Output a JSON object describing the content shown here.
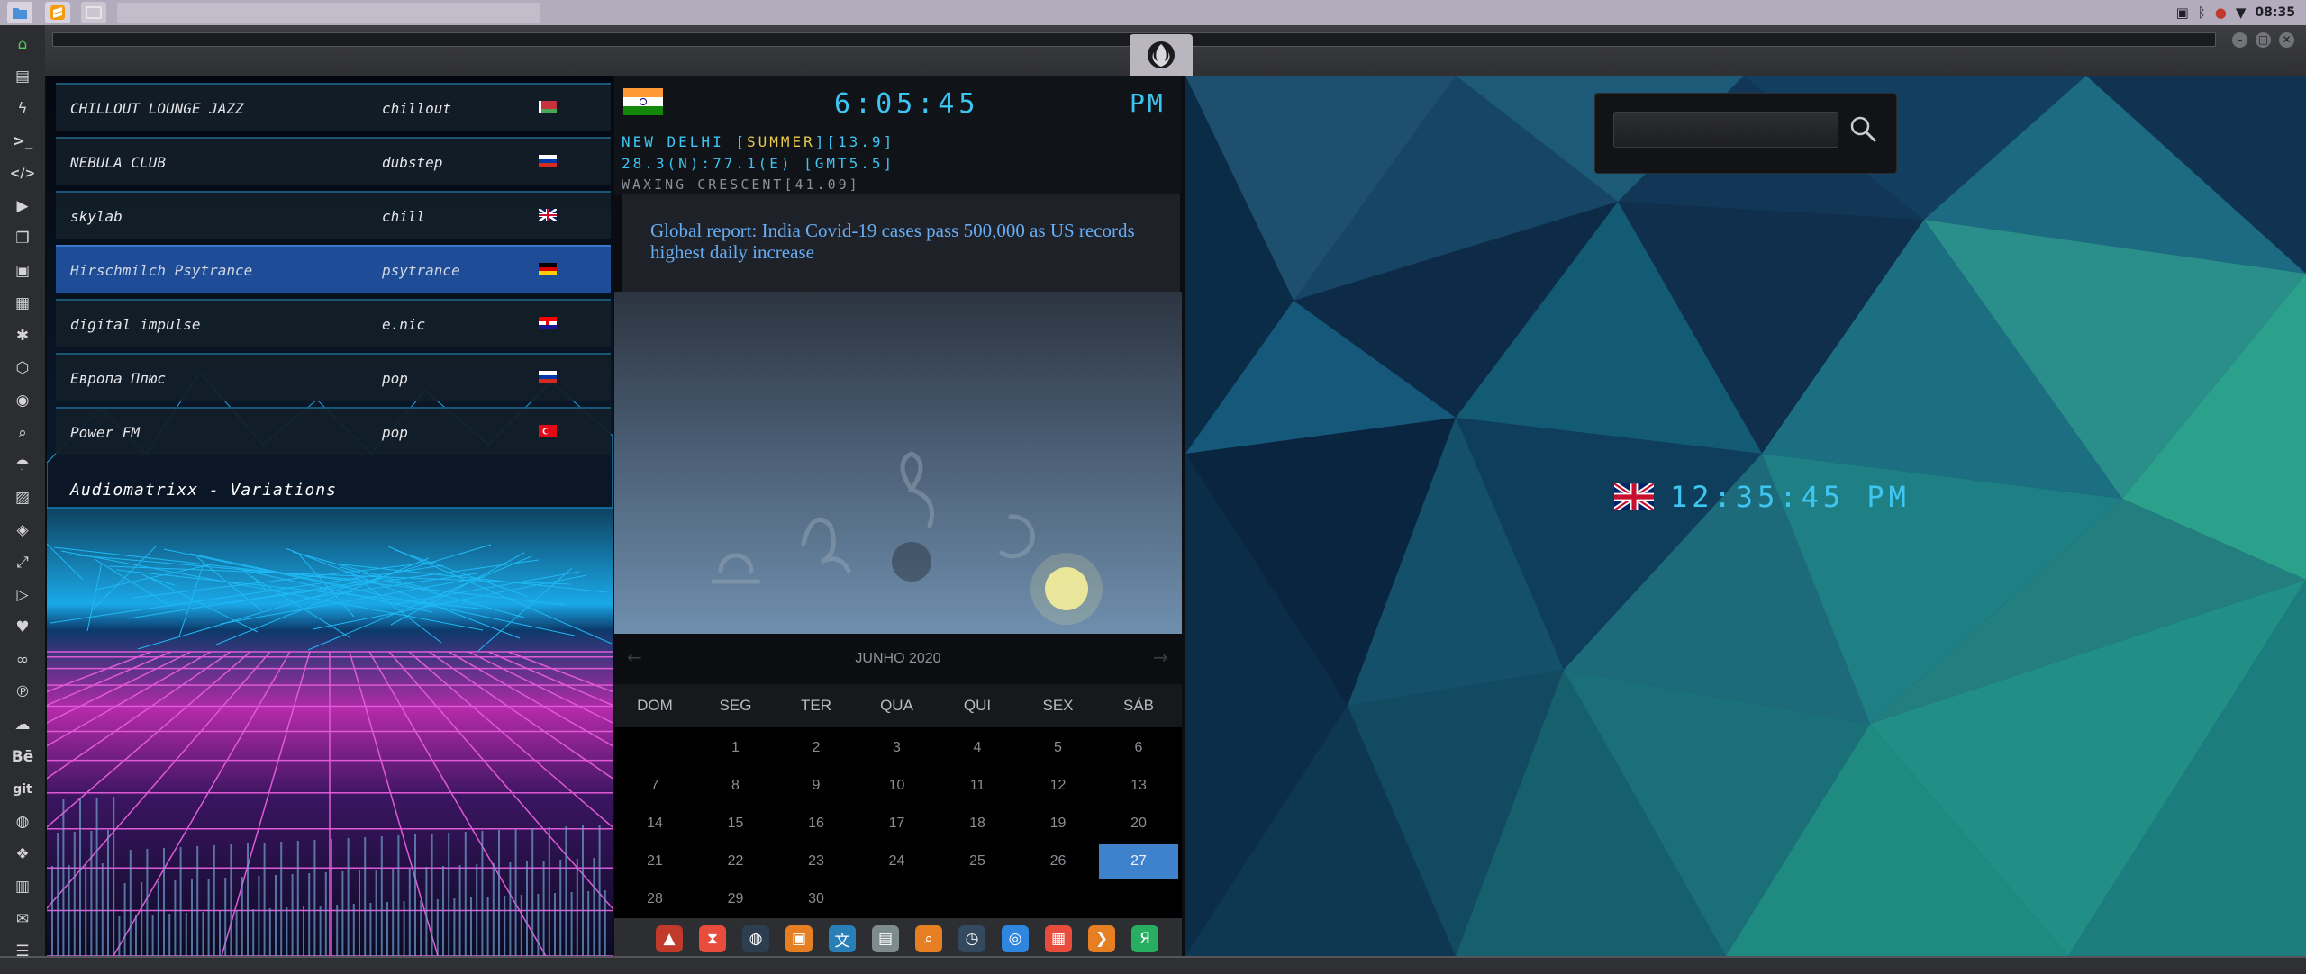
{
  "top_panel": {
    "launchers": [
      {
        "icon": "file-manager-icon"
      },
      {
        "icon": "sublime-text-icon"
      },
      {
        "icon": "app-grid-icon"
      }
    ],
    "tray_icons": [
      "image-icon",
      "bluetooth-icon",
      "alert-icon",
      "wifi-icon"
    ],
    "clock": "08:35"
  },
  "sidebar": {
    "items": [
      {
        "name": "home-icon",
        "glyph": "⌂"
      },
      {
        "name": "document-icon",
        "glyph": "▤"
      },
      {
        "name": "lightning-icon",
        "glyph": "ϟ"
      },
      {
        "name": "terminal-icon",
        "glyph": ">_"
      },
      {
        "name": "code-icon",
        "glyph": "</>"
      },
      {
        "name": "play-icon",
        "glyph": "▶"
      },
      {
        "name": "copy-icon",
        "glyph": "❐"
      },
      {
        "name": "image-icon",
        "glyph": "▣"
      },
      {
        "name": "reader-icon",
        "glyph": "▦"
      },
      {
        "name": "aperture-icon",
        "glyph": "✱"
      },
      {
        "name": "hexagon-icon",
        "glyph": "⬡"
      },
      {
        "name": "globe-icon",
        "glyph": "◉"
      },
      {
        "name": "search-icon",
        "glyph": "⌕"
      },
      {
        "name": "umbrella-icon",
        "glyph": "☂"
      },
      {
        "name": "contact-icon",
        "glyph": "▨"
      },
      {
        "name": "tag-icon",
        "glyph": "◈"
      },
      {
        "name": "expand-icon",
        "glyph": "⤢"
      },
      {
        "name": "youtube-icon",
        "glyph": "▷"
      },
      {
        "name": "heart-icon",
        "glyph": "♥"
      },
      {
        "name": "lastfm-icon",
        "glyph": "∞"
      },
      {
        "name": "pinterest-icon",
        "glyph": "℗"
      },
      {
        "name": "cloud-icon",
        "glyph": "☁"
      },
      {
        "name": "behance-icon",
        "glyph": "Bē"
      },
      {
        "name": "git-icon",
        "glyph": "git"
      },
      {
        "name": "github-icon",
        "glyph": "◍"
      },
      {
        "name": "dropbox-icon",
        "glyph": "❖"
      },
      {
        "name": "map-icon",
        "glyph": "▥"
      },
      {
        "name": "mail-icon",
        "glyph": "✉"
      },
      {
        "name": "storage-icon",
        "glyph": "☰"
      }
    ]
  },
  "radio": {
    "stations": [
      {
        "name": "CHILLOUT LOUNGE JAZZ",
        "genre": "chillout",
        "flag": "by",
        "selected": false
      },
      {
        "name": "NEBULA CLUB",
        "genre": "dubstep",
        "flag": "ru",
        "selected": false
      },
      {
        "name": "skylab",
        "genre": "chill",
        "flag": "gb",
        "selected": false
      },
      {
        "name": "Hirschmilch Psytrance",
        "genre": "psytrance",
        "flag": "de",
        "selected": true
      },
      {
        "name": "digital impulse",
        "genre": "e.nic",
        "flag": "hr",
        "selected": false
      },
      {
        "name": "Европа Плюс",
        "genre": "pop",
        "flag": "ru",
        "selected": false
      },
      {
        "name": "Power FM",
        "genre": "pop",
        "flag": "tr",
        "selected": false
      }
    ],
    "now_playing": "Audiomatrixx - Variations"
  },
  "clock_widget": {
    "time": "6:05:45",
    "ampm": "PM",
    "line1_pre": "NEW DELHI [",
    "line1_season": "SUMMER",
    "line1_post": "][13.9]",
    "line2": "28.3(N):77.1(E) [GMT5.5]",
    "line3": "WAXING CRESCENT[41.09]"
  },
  "news": {
    "headline": "Global report: India Covid-19 cases pass 500,000 as US records highest daily increase"
  },
  "calendar": {
    "month": "JUNHO 2020",
    "weekdays": [
      "DOM",
      "SEG",
      "TER",
      "QUA",
      "QUI",
      "SEX",
      "SÁB"
    ],
    "first_weekday_index": 1,
    "days_in_month": 30,
    "today": 27
  },
  "dock": {
    "apps": [
      {
        "name": "app-red-icon",
        "color": "#c0392b",
        "glyph": "▲"
      },
      {
        "name": "timer-icon",
        "color": "#e74c3c",
        "glyph": "⧗"
      },
      {
        "name": "globe-dark-icon",
        "color": "#2c3e50",
        "glyph": "◍"
      },
      {
        "name": "photos-icon",
        "color": "#e67e22",
        "glyph": "▣"
      },
      {
        "name": "translate-icon",
        "color": "#2980b9",
        "glyph": "文"
      },
      {
        "name": "news-icon",
        "color": "#7f8c8d",
        "glyph": "▤"
      },
      {
        "name": "magnifier-icon",
        "color": "#e67e22",
        "glyph": "⌕"
      },
      {
        "name": "clock-icon",
        "color": "#34495e",
        "glyph": "◷"
      },
      {
        "name": "web-icon",
        "color": "#2e86de",
        "glyph": "◎"
      },
      {
        "name": "calendar-icon",
        "color": "#e74c3c",
        "glyph": "▦"
      },
      {
        "name": "arrow-icon",
        "color": "#e67e22",
        "glyph": "❯"
      },
      {
        "name": "yandex-icon",
        "color": "#27ae60",
        "glyph": "Я"
      }
    ]
  },
  "right_panel": {
    "search_placeholder": "",
    "uk_time": "12:35:45 PM"
  },
  "colors": {
    "accent_lcd": "#3ec4f0",
    "selected_row": "#1f4c97",
    "calendar_today": "#3f82cc",
    "season_highlight": "#e8c94a"
  }
}
